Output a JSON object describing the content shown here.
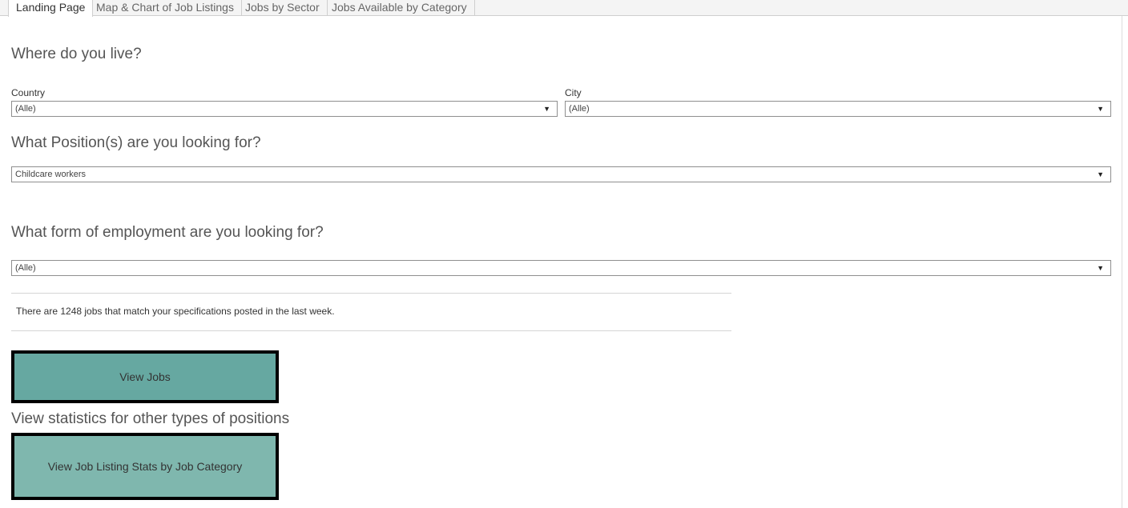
{
  "tabs": [
    {
      "label": "Landing Page"
    },
    {
      "label": "Map & Chart of Job Listings"
    },
    {
      "label": "Jobs by Sector"
    },
    {
      "label": "Jobs Available by Category"
    }
  ],
  "location": {
    "heading": "Where do you live?",
    "country_label": "Country",
    "country_value": "(Alle)",
    "city_label": "City",
    "city_value": "(Alle)"
  },
  "position": {
    "heading": "What Position(s) are you looking for?",
    "value": "Childcare workers"
  },
  "employment": {
    "heading": "What form of employment are you looking for?",
    "value": "(Alle)"
  },
  "summary": {
    "text": "There are 1248 jobs that match your specifications posted in the last week."
  },
  "actions": {
    "view_jobs_label": "View Jobs",
    "stats_heading": "View statistics for other types of positions",
    "stats_button_label": "View Job Listing Stats by Job Category"
  },
  "colors": {
    "view_jobs_button": "#66a8a1",
    "stats_button": "#7fb7ae"
  },
  "icons": {
    "dropdown": "caret-down-icon"
  }
}
